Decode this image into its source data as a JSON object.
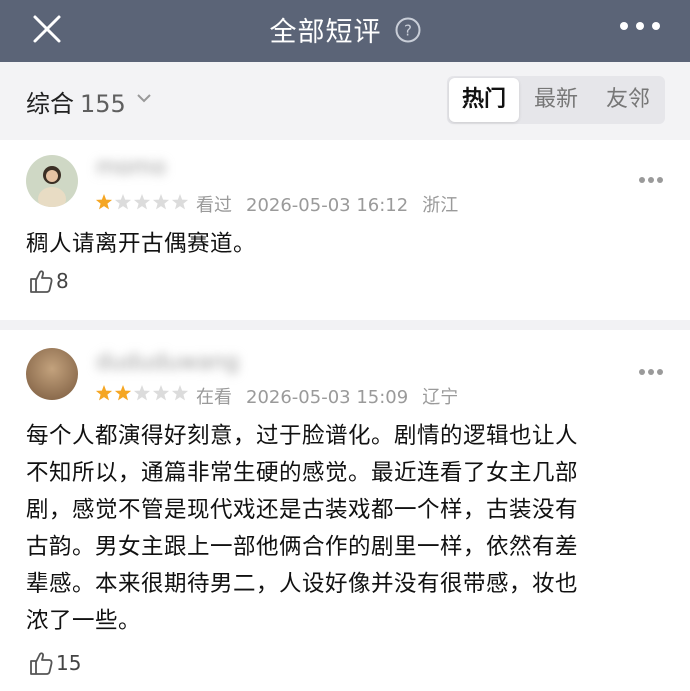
{
  "header": {
    "title": "全部短评",
    "icons": {
      "close": "close-icon",
      "help": "help-icon",
      "more": "more-horizontal-icon"
    },
    "background_color": "#5b6477"
  },
  "filter": {
    "sort_label": "综合",
    "count": "155",
    "tabs": [
      {
        "label": "热门",
        "selected": true
      },
      {
        "label": "最新",
        "selected": false
      },
      {
        "label": "友邻",
        "selected": false
      }
    ]
  },
  "reviews": [
    {
      "username": "momo",
      "rating": 1,
      "status": "看过",
      "datetime": "2026-05-03 16:12",
      "location": "浙江",
      "content": "稠人请离开古偶赛道。",
      "likes": "8"
    },
    {
      "username": "dududuwang",
      "rating": 2,
      "status": "在看",
      "datetime": "2026-05-03 15:09",
      "location": "辽宁",
      "content_lines": [
        "每个人都演得好刻意，过于脸谱化。剧情的逻辑也让人",
        "不知所以，通篇非常生硬的感觉。最近连看了女主几部",
        "剧，感觉不管是现代戏还是古装戏都一个样，古装没有",
        "古韵。男女主跟上一部他俩合作的剧里一样，依然有差",
        "辈感。本来很期待男二，人设好像并没有很带感，妆也",
        "浓了一些。"
      ],
      "likes": "15"
    }
  ],
  "colors": {
    "star_filled": "#f5a623",
    "star_empty": "#dcdcdc"
  }
}
